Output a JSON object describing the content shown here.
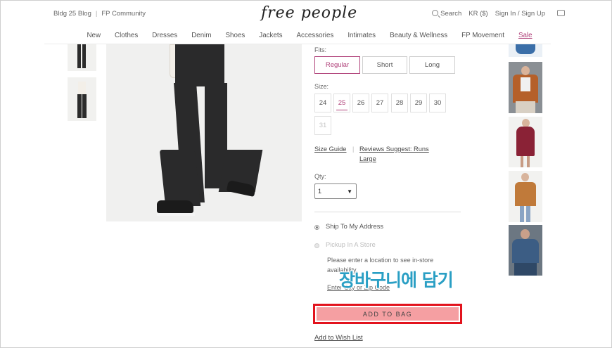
{
  "header": {
    "blog_link": "Bldg 25 Blog",
    "community_link": "FP Community",
    "logo_text": "free people",
    "search_label": "Search",
    "currency": "KR ($)",
    "account_link": "Sign In / Sign Up"
  },
  "nav": {
    "items": [
      "New",
      "Clothes",
      "Dresses",
      "Denim",
      "Shoes",
      "Jackets",
      "Accessories",
      "Intimates",
      "Beauty & Wellness",
      "FP Movement",
      "Sale"
    ]
  },
  "product": {
    "fits_label": "Fits:",
    "fits": [
      "Regular",
      "Short",
      "Long"
    ],
    "selected_fit": "Regular",
    "size_label": "Size:",
    "sizes": [
      "24",
      "25",
      "26",
      "27",
      "28",
      "29",
      "30",
      "31"
    ],
    "selected_size": "25",
    "unavailable_sizes": [
      "31"
    ],
    "size_guide_link": "Size Guide",
    "reviews_link_line1": "Reviews Suggest: Runs",
    "reviews_link_line2": "Large",
    "qty_label": "Qty:",
    "qty_value": "1",
    "ship_option": "Ship To My Address",
    "pickup_option": "Pickup In A Store",
    "pickup_note": "Please enter a location to see in-store availability.",
    "zip_link": "Enter City or Zip Code",
    "add_to_bag": "ADD TO BAG",
    "wishlist_link": "Add to Wish List"
  },
  "overlay": {
    "caption": "장바구니에 담기"
  },
  "colors": {
    "accent": "#b0427a",
    "highlight_border": "#e2131d",
    "button_fill": "#f59fa2",
    "overlay_text": "#2a9fc4"
  }
}
